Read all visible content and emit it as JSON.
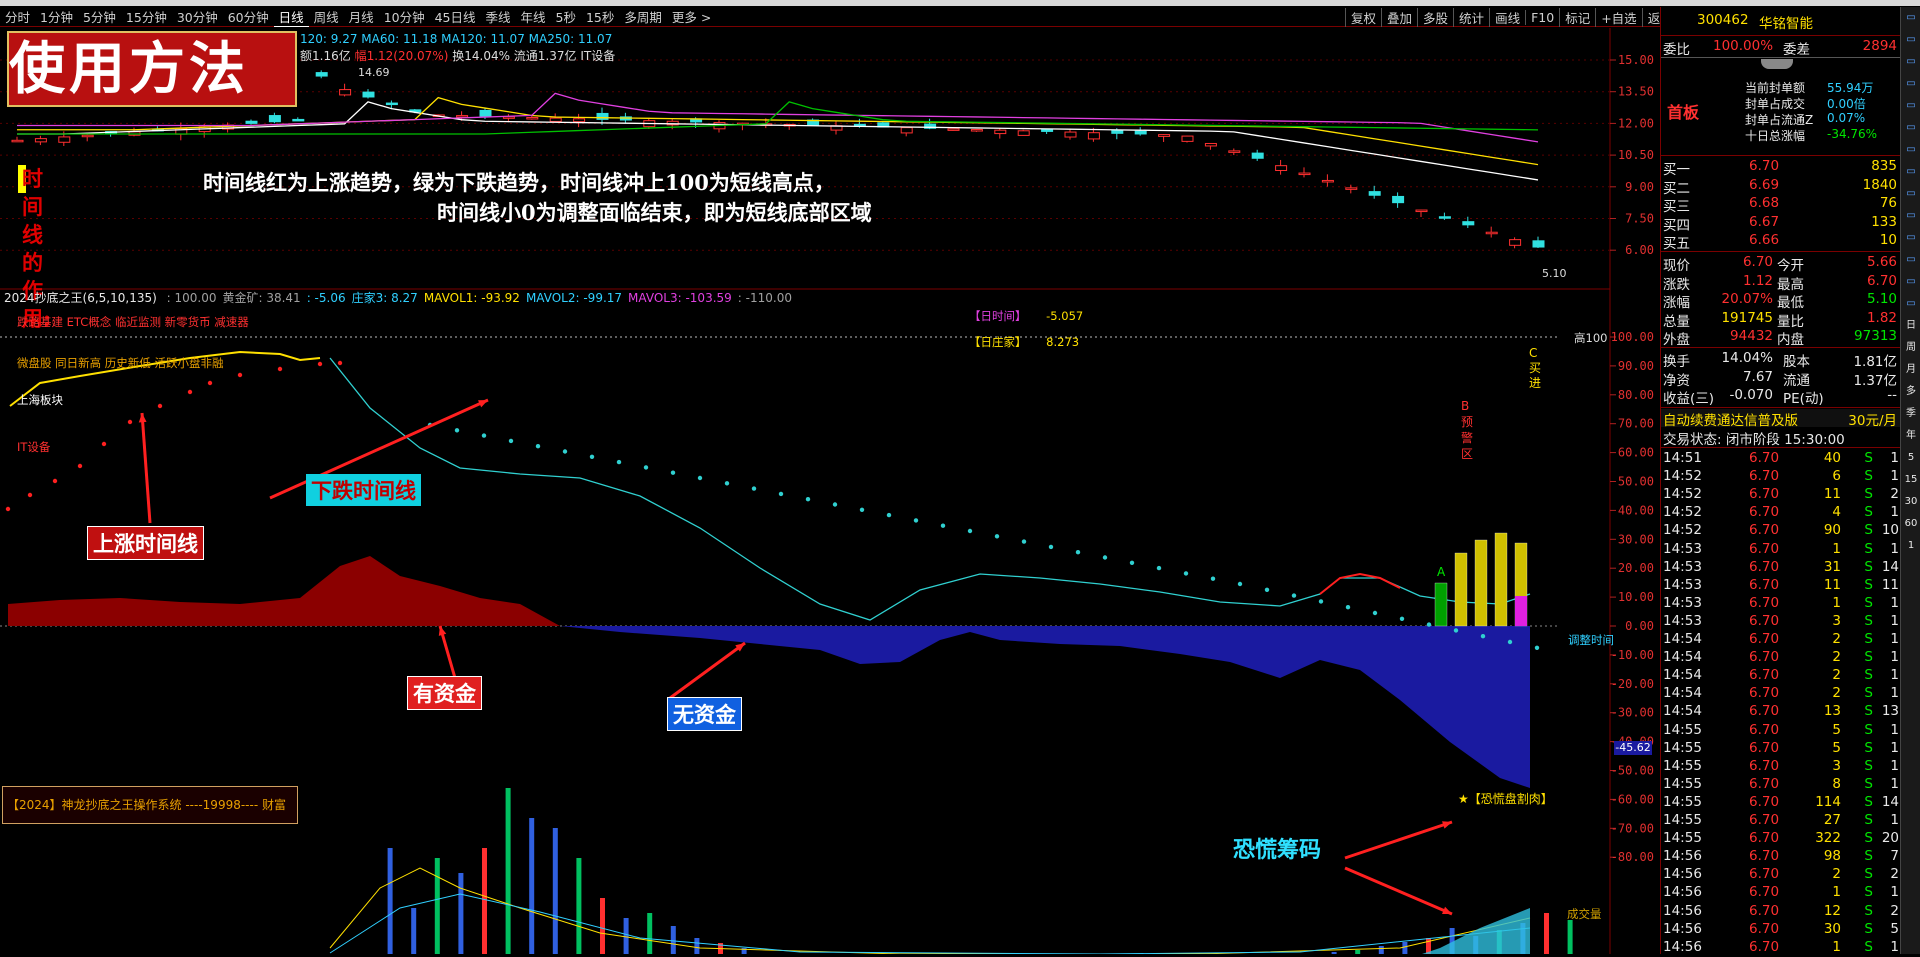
{
  "periods": [
    "分时",
    "1分钟",
    "5分钟",
    "15分钟",
    "30分钟",
    "60分钟",
    "日线",
    "周线",
    "月线",
    "10分钟",
    "45日线",
    "季线",
    "年线",
    "5秒",
    "15秒",
    "多周期",
    "更多 >"
  ],
  "toolbar": [
    "复权",
    "叠加",
    "多股",
    "统计",
    "画线",
    "F10",
    "标记",
    "+自选",
    "返回"
  ],
  "banner": {
    "title": "使用方法"
  },
  "main_info": {
    "ma_line": "120: 9.27  MA60: 11.18  MA120: 11.07  MA250: 11.07",
    "info2_a": "额1.16亿",
    "info2_b": "幅1.12(20.07%)",
    "info2_c": "换14.04%  流通1.37亿  IT设备",
    "high_label": "14.69",
    "low_label": "5.10",
    "chart_ticks": [
      "15.00",
      "13.50",
      "12.00",
      "10.50",
      "9.00",
      "7.50",
      "6.00"
    ]
  },
  "explain": {
    "tag": "时间线的作用:",
    "line1": "时间线红为上涨趋势，绿为下跌趋势，时间线冲上100为短线高点，",
    "line2": "时间线小0为调整面临结束，即为短线底部区域"
  },
  "indicator": {
    "name": "2024抄底之王(6,5,10,135)",
    "items": [
      {
        "t": ": 100.00",
        "c": "#a0a0a0"
      },
      {
        "t": "黄金矿: 38.41",
        "c": "#a0a0a0"
      },
      {
        "t": ": -5.06",
        "c": "#30d0ff"
      },
      {
        "t": "庄家3: 8.27",
        "c": "#30d0ff"
      },
      {
        "t": "MAVOL1: -93.92",
        "c": "#ffe000"
      },
      {
        "t": "MAVOL2: -99.17",
        "c": "#30d0ff"
      },
      {
        "t": "MAVOL3: -103.59",
        "c": "#e040e0"
      },
      {
        "t": ": -110.00",
        "c": "#a0a0a0"
      }
    ],
    "concepts1": "跌路基建 ETC概念 临近监测 新零货币 减速器",
    "concepts2": "微盘股 同日新高 历史新低 活跃小盘非融",
    "board": "上海板块",
    "industry": "IT设备",
    "day_time_label": "【日时间】",
    "day_time_value": "-5.057",
    "day_zj_label": "【日庄家】",
    "day_zj_value": "8.273",
    "high_mark": "高100",
    "adjust_mark": "调整时间",
    "vol_mark": "成交量",
    "current_value": "-45.62",
    "ind_ticks": [
      "100.00",
      "90.00",
      "80.00",
      "70.00",
      "60.00",
      "50.00",
      "40.00",
      "30.00",
      "20.00",
      "10.00",
      "0.00",
      "-10.00",
      "-20.00",
      "-30.00",
      "-40.00",
      "-50.00",
      "-60.00",
      "-70.00",
      "-80.00"
    ],
    "buy_signal": "C买进",
    "warn_signal": "B预警区",
    "a_signal": "A",
    "system_label": "【2024】神龙抄底之王操作系统   ----19998---- 财富",
    "panic_label": "★【恐慌盘割肉】"
  },
  "annotations": {
    "up_line": "上涨时间线",
    "down_line": "下跌时间线",
    "has_fund": "有资金",
    "no_fund": "无资金",
    "panic": "恐慌筹码"
  },
  "right_panel": {
    "code": "300462",
    "name": "华铭智能",
    "wb_label": "委比",
    "wb_value": "100.00%",
    "wc_label": "委差",
    "wc_value": "2894",
    "first_board": "首板",
    "seal_rows": [
      {
        "label": "当前封单额",
        "value": "55.94万"
      },
      {
        "label": "封单占成交",
        "value": "0.00倍"
      },
      {
        "label": "封单占流通Z",
        "value": "0.07%"
      },
      {
        "label": "十日总涨幅",
        "value": "-34.76%"
      }
    ],
    "buys": [
      {
        "label": "买一",
        "price": "6.70",
        "vol": "835"
      },
      {
        "label": "买二",
        "price": "6.69",
        "vol": "1840"
      },
      {
        "label": "买三",
        "price": "6.68",
        "vol": "76"
      },
      {
        "label": "买四",
        "price": "6.67",
        "vol": "133"
      },
      {
        "label": "买五",
        "price": "6.66",
        "vol": "10"
      }
    ],
    "quotes": [
      {
        "l1": "现价",
        "v1": "6.70",
        "l2": "今开",
        "v2": "5.66",
        "c1": "#ff3030",
        "c2": "#ff3030"
      },
      {
        "l1": "涨跌",
        "v1": "1.12",
        "l2": "最高",
        "v2": "6.70",
        "c1": "#ff3030",
        "c2": "#ff3030"
      },
      {
        "l1": "涨幅",
        "v1": "20.07%",
        "l2": "最低",
        "v2": "5.10",
        "c1": "#ff3030",
        "c2": "#00e600"
      },
      {
        "l1": "总量",
        "v1": "191745",
        "l2": "量比",
        "v2": "1.82",
        "c1": "#ffe000",
        "c2": "#ff3030"
      },
      {
        "l1": "外盘",
        "v1": "94432",
        "l2": "内盘",
        "v2": "97313",
        "c1": "#ff3030",
        "c2": "#00e600"
      }
    ],
    "stats": [
      {
        "l1": "换手",
        "v1": "14.04%",
        "l2": "股本",
        "v2": "1.81亿"
      },
      {
        "l1": "净资",
        "v1": "7.67",
        "l2": "流通",
        "v2": "1.37亿"
      },
      {
        "l1": "收益(三)",
        "v1": "-0.070",
        "l2": "PE(动)",
        "v2": "--"
      }
    ],
    "promo": "自动续费通达信普及版",
    "promo_price": "30元/月",
    "trade_state": "交易状态: 闭市阶段 15:30:00",
    "ticks": [
      [
        "14:51",
        "6.70",
        "40",
        "S",
        "1"
      ],
      [
        "14:52",
        "6.70",
        "6",
        "S",
        "1"
      ],
      [
        "14:52",
        "6.70",
        "11",
        "S",
        "2"
      ],
      [
        "14:52",
        "6.70",
        "4",
        "S",
        "1"
      ],
      [
        "14:52",
        "6.70",
        "90",
        "S",
        "10"
      ],
      [
        "14:53",
        "6.70",
        "1",
        "S",
        "1"
      ],
      [
        "14:53",
        "6.70",
        "31",
        "S",
        "14"
      ],
      [
        "14:53",
        "6.70",
        "11",
        "S",
        "11"
      ],
      [
        "14:53",
        "6.70",
        "1",
        "S",
        "1"
      ],
      [
        "14:53",
        "6.70",
        "3",
        "S",
        "1"
      ],
      [
        "14:54",
        "6.70",
        "2",
        "S",
        "1"
      ],
      [
        "14:54",
        "6.70",
        "2",
        "S",
        "1"
      ],
      [
        "14:54",
        "6.70",
        "2",
        "S",
        "1"
      ],
      [
        "14:54",
        "6.70",
        "2",
        "S",
        "1"
      ],
      [
        "14:54",
        "6.70",
        "13",
        "S",
        "13"
      ],
      [
        "14:55",
        "6.70",
        "5",
        "S",
        "1"
      ],
      [
        "14:55",
        "6.70",
        "5",
        "S",
        "1"
      ],
      [
        "14:55",
        "6.70",
        "3",
        "S",
        "1"
      ],
      [
        "14:55",
        "6.70",
        "8",
        "S",
        "1"
      ],
      [
        "14:55",
        "6.70",
        "114",
        "S",
        "14"
      ],
      [
        "14:55",
        "6.70",
        "27",
        "S",
        "1"
      ],
      [
        "14:55",
        "6.70",
        "322",
        "S",
        "20"
      ],
      [
        "14:56",
        "6.70",
        "98",
        "S",
        "7"
      ],
      [
        "14:56",
        "6.70",
        "2",
        "S",
        "2"
      ],
      [
        "14:56",
        "6.70",
        "1",
        "S",
        "1"
      ],
      [
        "14:56",
        "6.70",
        "12",
        "S",
        "2"
      ],
      [
        "14:56",
        "6.70",
        "30",
        "S",
        "5"
      ],
      [
        "14:56",
        "6.70",
        "1",
        "S",
        "1"
      ]
    ]
  },
  "side_tools": [
    "日",
    "周",
    "月",
    "多",
    "季",
    "年",
    "5",
    "15",
    "30",
    "60",
    "1"
  ],
  "colors": {
    "up": "#ff3030",
    "down": "#00e6e6",
    "fund_pos": "#8b0000",
    "fund_neg": "#1a1aa0",
    "time_line_up": "#ff2020",
    "time_line_down": "#30d0d0"
  }
}
